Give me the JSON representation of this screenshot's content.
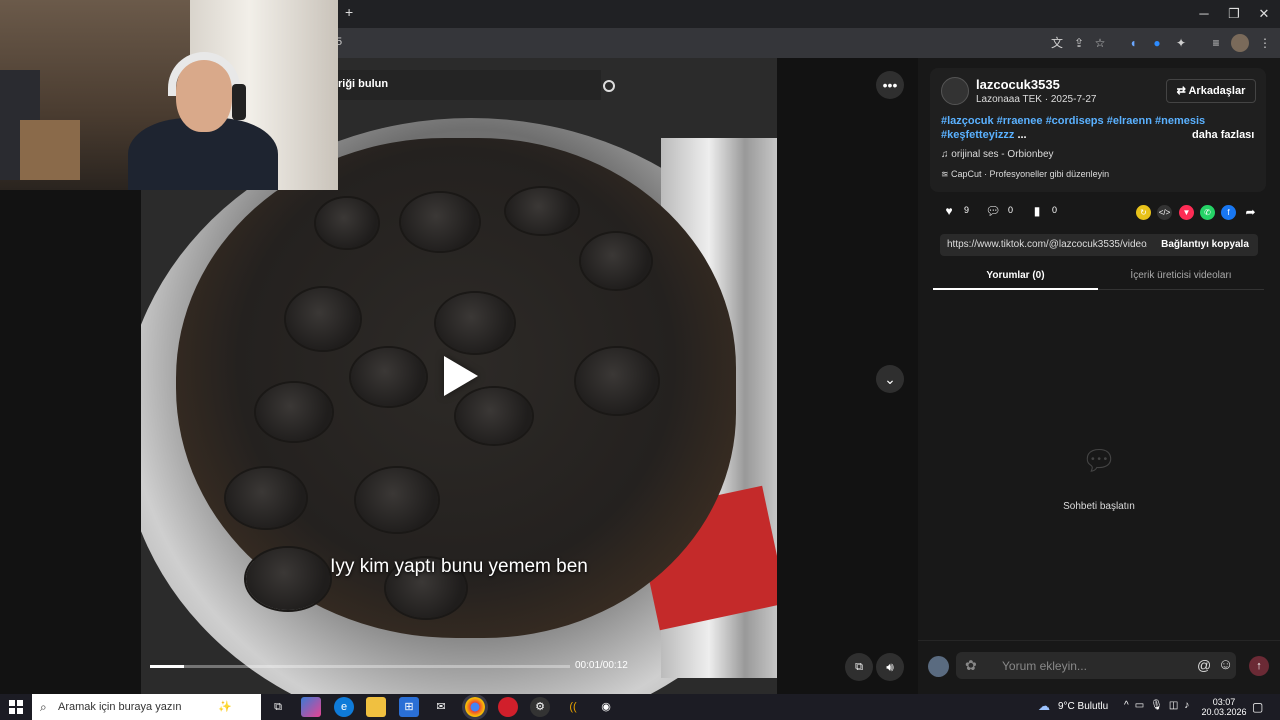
{
  "browser": {
    "new_tab": "+",
    "url_fragment": "5",
    "window_controls": {
      "minimize": "─",
      "restore": "❐",
      "close": "✕"
    }
  },
  "video": {
    "search_fragment": "riği bulun",
    "caption": "Iyy kim yaptı bunu yemem ben",
    "time": "00:01/00:12",
    "progress_fraction": 0.08
  },
  "post": {
    "username": "lazcocuk3535",
    "subline": "Lazonaaa TEK · 2025-7-27",
    "friends_button": "⇄ Arkadaşlar",
    "tags_line1": "#lazçocuk #rraenee #cordiseps #elraenn #nemesis",
    "tags_line2": "#keşfetteyizzz",
    "tags_ellipsis": "...",
    "more": "daha fazlası",
    "sound": "orijinal ses - Orbionbey",
    "capcut": "CapCut · Profesyoneller gibi düzenleyin",
    "likes": "9",
    "comments": "0",
    "saves": "0",
    "link": "https://www.tiktok.com/@lazcocuk3535/video/",
    "copy_button": "Bağlantıyı kopyala",
    "tab_comments": "Yorumlar (0)",
    "tab_creator": "İçerik üreticisi videoları",
    "empty_text": "Sohbeti başlatın",
    "comment_placeholder": "Yorum ekleyin..."
  },
  "taskbar": {
    "search_placeholder": "Aramak için buraya yazın",
    "weather": "9°C  Bulutlu",
    "time": "03:07",
    "date": "20.03.2026"
  },
  "colors": {
    "accent_link": "#5ab1ff",
    "send": "#6b2a35"
  }
}
